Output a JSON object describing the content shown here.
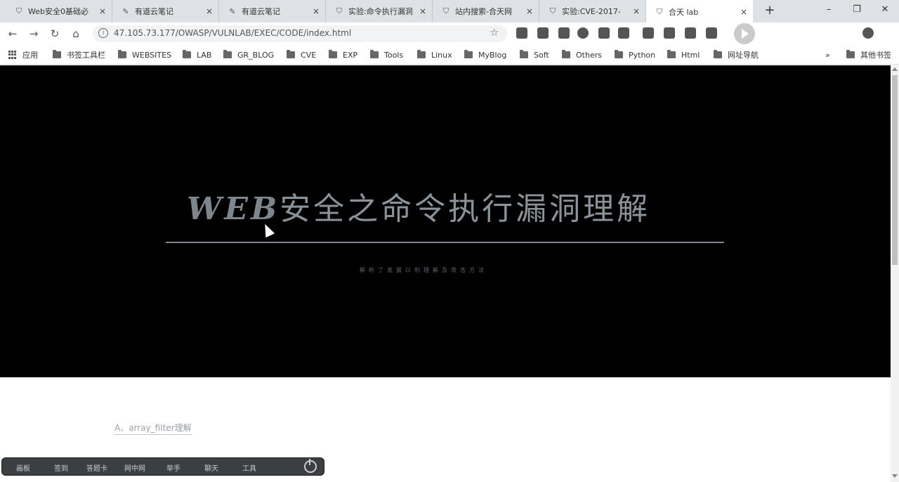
{
  "tabs": [
    {
      "label": "Web安全0基础必",
      "icon": "shield-icon"
    },
    {
      "label": "有道云笔记",
      "icon": "note-icon"
    },
    {
      "label": "有道云笔记",
      "icon": "note-icon"
    },
    {
      "label": "实验:命令执行漏洞",
      "icon": "shield-icon"
    },
    {
      "label": "站内搜索-合天网",
      "icon": "shield-icon"
    },
    {
      "label": "实验:CVE-2017-",
      "icon": "shield-icon"
    },
    {
      "label": "合天 lab",
      "icon": "shield-icon",
      "active": true
    }
  ],
  "tab_close": "×",
  "new_tab": "+",
  "window_controls": {
    "minimize": "–",
    "restore": "❐",
    "close": "✕"
  },
  "nav": {
    "back": "←",
    "forward": "→",
    "reload": "↻",
    "home": "⌂"
  },
  "address": {
    "info": "i",
    "url": "47.105.73.177/OWASP/VULNLAB/EXEC/CODE/index.html",
    "star": "☆"
  },
  "bookmarks": {
    "apps": "应用",
    "items": [
      "书签工具栏",
      "WEBSITES",
      "LAB",
      "GR_BLOG",
      "CVE",
      "EXP",
      "Tools",
      "Linux",
      "MyBlog",
      "Soft",
      "Others",
      "Python",
      "Html",
      "网址导航"
    ],
    "overflow": "»",
    "other": "其他书签"
  },
  "hero": {
    "title_web": "WEB",
    "title_rest": "安全之命令执行漏洞理解",
    "subtitle": "解析了发展以利理解及攻击方法"
  },
  "content": {
    "link": "A、array_filter理解"
  },
  "taskbar": {
    "items": [
      "画板",
      "签到",
      "答题卡",
      "网中网",
      "举手",
      "聊天",
      "工具"
    ],
    "power": "power-icon"
  }
}
